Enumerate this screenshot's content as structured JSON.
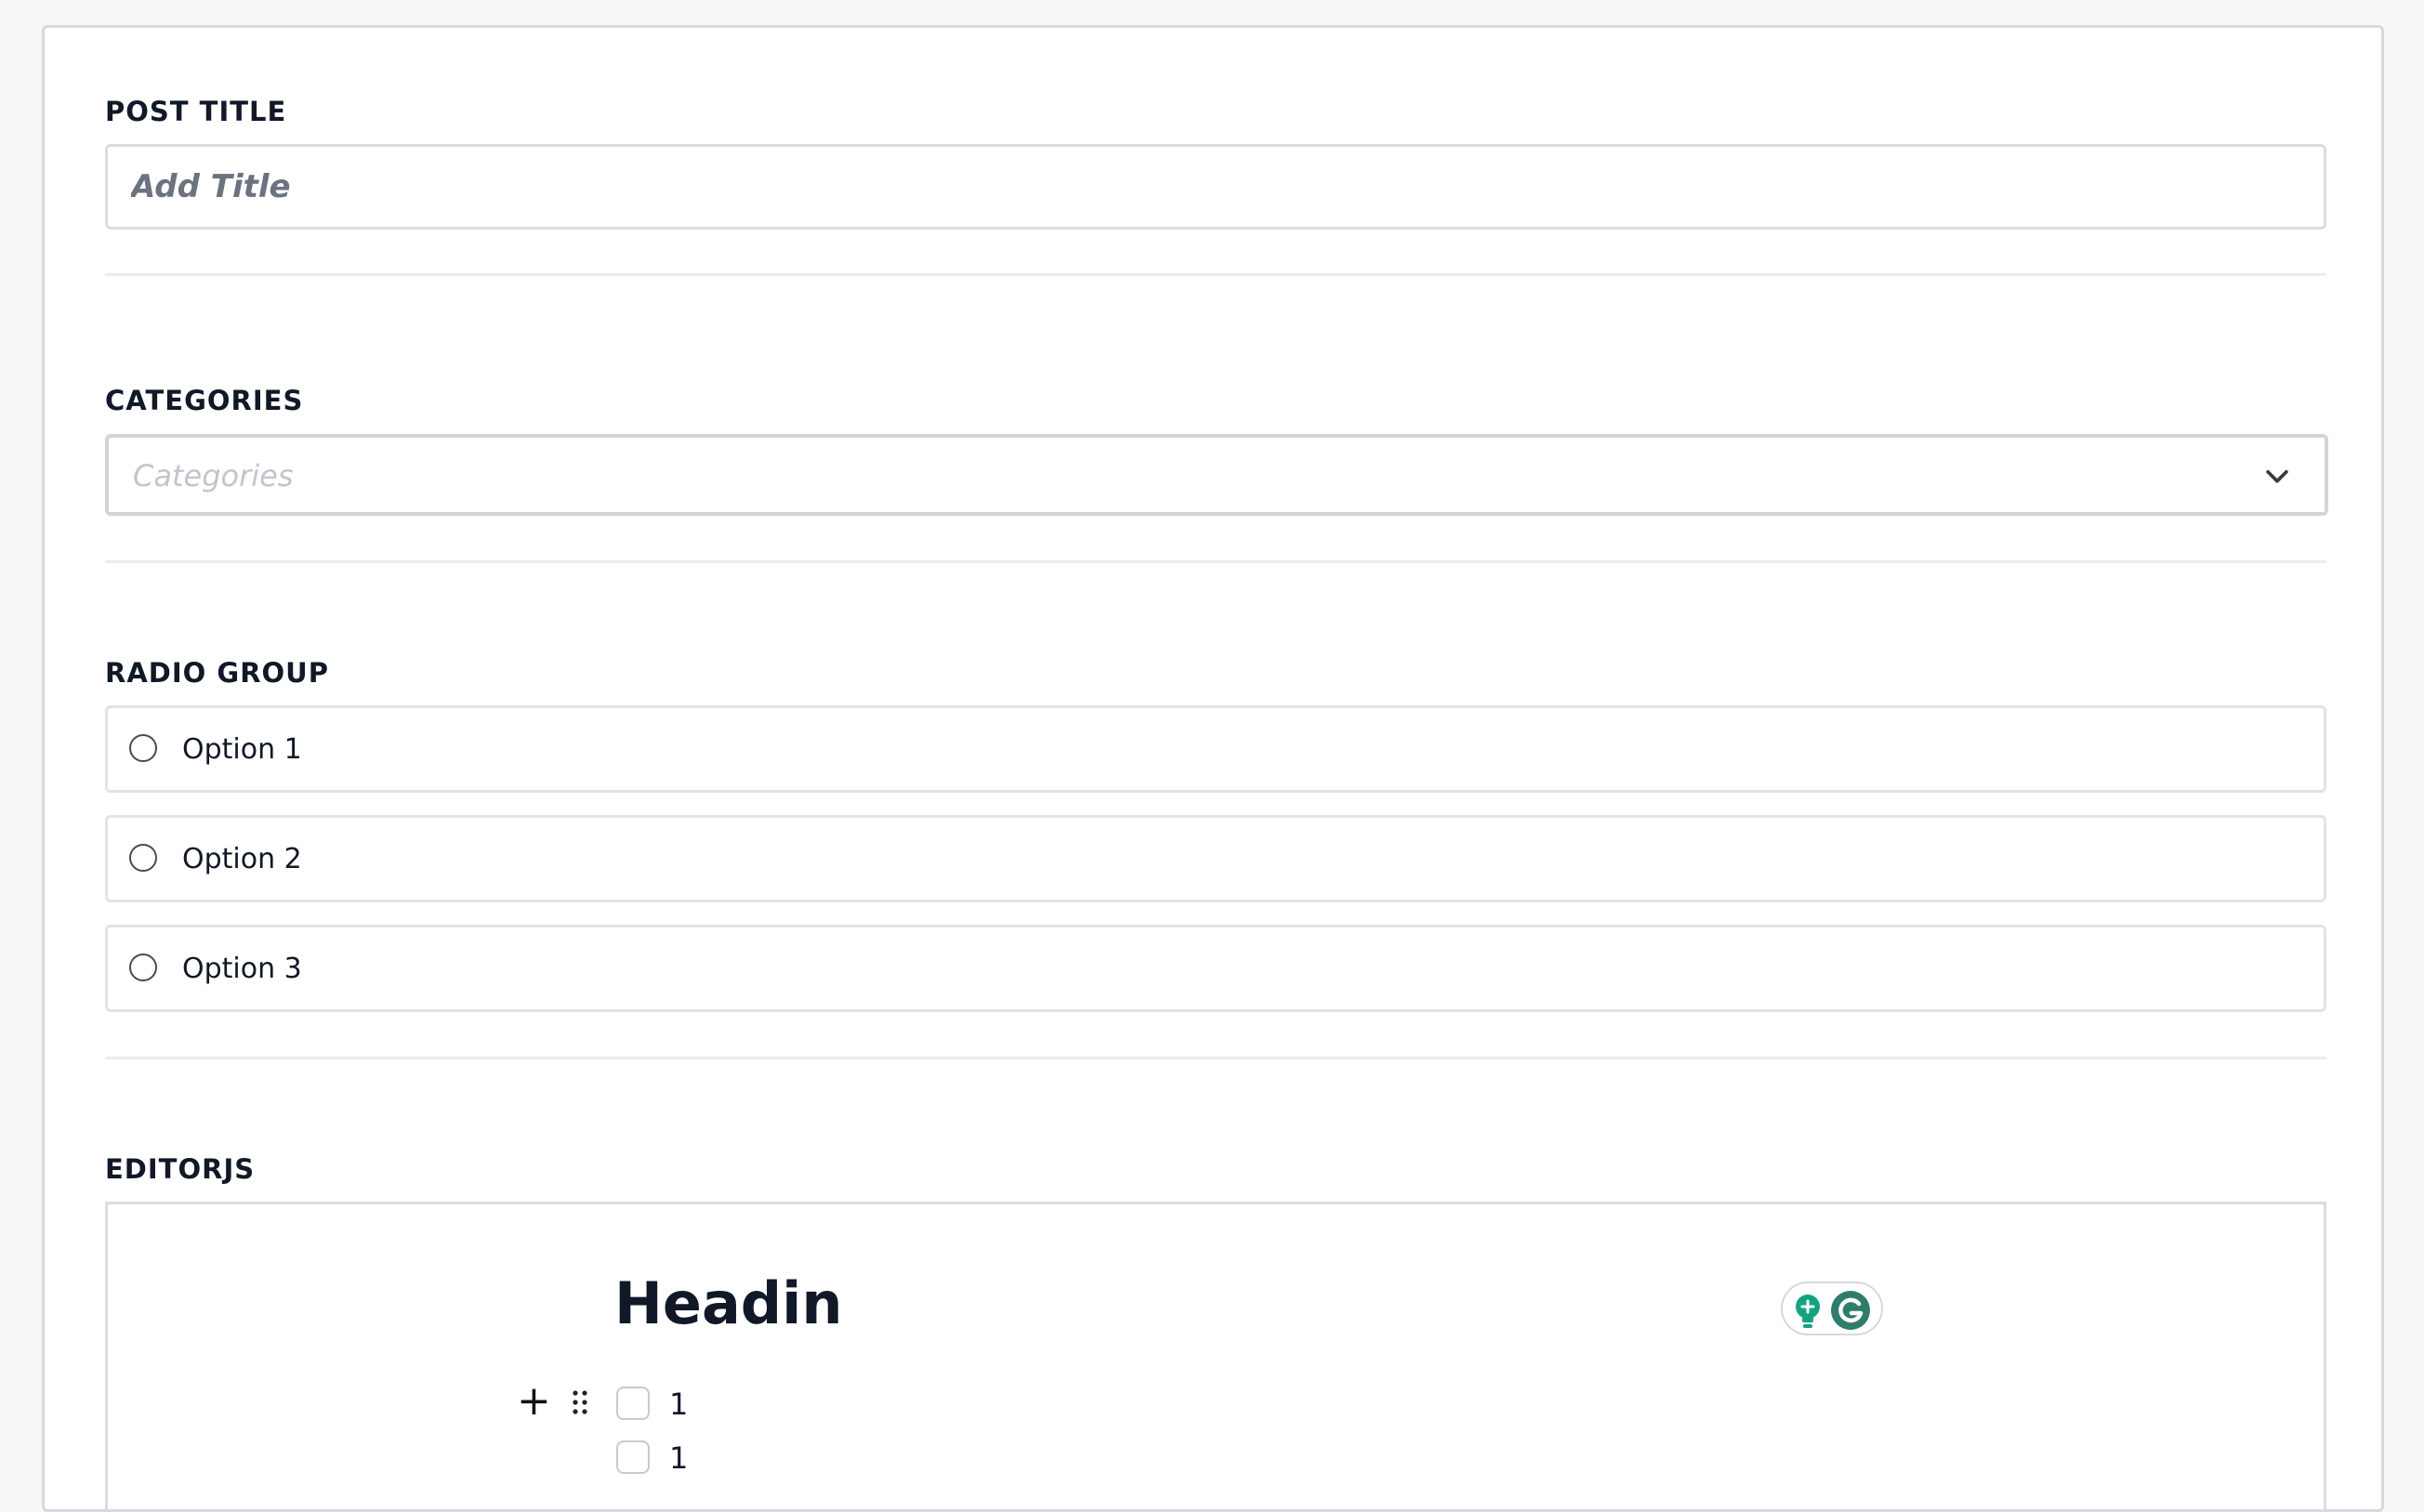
{
  "form": {
    "post_title": {
      "label": "POST TITLE",
      "placeholder": "Add Title",
      "value": ""
    },
    "categories": {
      "label": "CATEGORIES",
      "placeholder": "Categories",
      "icon": "chevron-down-icon"
    },
    "radio_group": {
      "label": "RADIO GROUP",
      "options": [
        {
          "label": "Option 1",
          "selected": false
        },
        {
          "label": "Option 2",
          "selected": false
        },
        {
          "label": "Option 3",
          "selected": false
        }
      ]
    },
    "editorjs": {
      "label": "EDITORJS",
      "heading": "Headin",
      "toolbar": {
        "plus_icon": "plus-icon",
        "drag_icon": "drag-handle-icon"
      },
      "checklist": [
        {
          "text": "1",
          "checked": false
        },
        {
          "text": "1",
          "checked": false
        }
      ],
      "extension_badge": {
        "icons": [
          "lightbulb-icon",
          "grammarly-icon"
        ],
        "colors": {
          "teal": "#15a37f",
          "dark_green": "#2e7d6b"
        }
      }
    }
  }
}
